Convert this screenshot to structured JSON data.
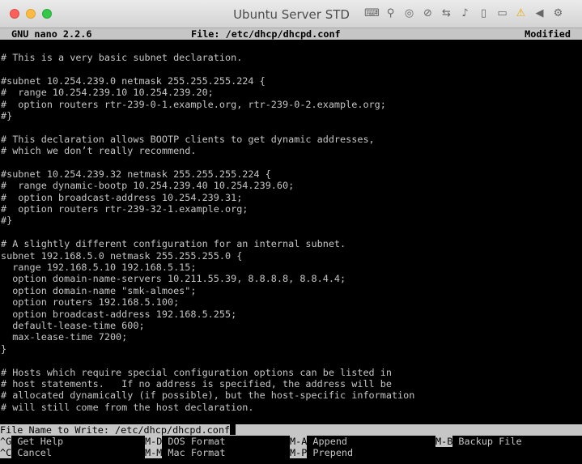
{
  "window": {
    "title": "Ubuntu Server STD",
    "toolbar_icons": [
      "keyboard-icon",
      "usb-icon",
      "disc-icon",
      "cd-blocked-icon",
      "network-icon",
      "audio-icon",
      "removable-drive-icon",
      "shared-folder-icon",
      "warning-icon",
      "back-arrow-icon",
      "settings-gear-icon"
    ]
  },
  "nano": {
    "version": "GNU nano 2.2.6",
    "file": "File: /etc/dhcp/dhcpd.conf",
    "status": "Modified"
  },
  "buffer": {
    "lines": [
      "# This is a very basic subnet declaration.",
      "",
      "#subnet 10.254.239.0 netmask 255.255.255.224 {",
      "#  range 10.254.239.10 10.254.239.20;",
      "#  option routers rtr-239-0-1.example.org, rtr-239-0-2.example.org;",
      "#}",
      "",
      "# This declaration allows BOOTP clients to get dynamic addresses,",
      "# which we don’t really recommend.",
      "",
      "#subnet 10.254.239.32 netmask 255.255.255.224 {",
      "#  range dynamic-bootp 10.254.239.40 10.254.239.60;",
      "#  option broadcast-address 10.254.239.31;",
      "#  option routers rtr-239-32-1.example.org;",
      "#}",
      "",
      "# A slightly different configuration for an internal subnet.",
      "subnet 192.168.5.0 netmask 255.255.255.0 {",
      "  range 192.168.5.10 192.168.5.15;",
      "  option domain-name-servers 10.211.55.39, 8.8.8.8, 8.8.4.4;",
      "  option domain-name \"smk-almoes\";",
      "  option routers 192.168.5.100;",
      "  option broadcast-address 192.168.5.255;",
      "  default-lease-time 600;",
      "  max-lease-time 7200;",
      "}",
      "",
      "# Hosts which require special configuration options can be listed in",
      "# host statements.   If no address is specified, the address will be",
      "# allocated dynamically (if possible), but the host-specific information",
      "# will still come from the host declaration."
    ]
  },
  "prompt": {
    "label": "File Name to Write: ",
    "value": "/etc/dhcp/dhcpd.conf"
  },
  "shortcuts": [
    {
      "key": "^G",
      "label": "Get Help"
    },
    {
      "key": "M-D",
      "label": "DOS Format"
    },
    {
      "key": "M-A",
      "label": "Append"
    },
    {
      "key": "M-B",
      "label": "Backup File"
    },
    {
      "key": "^C",
      "label": "Cancel"
    },
    {
      "key": "M-M",
      "label": "Mac Format"
    },
    {
      "key": "M-P",
      "label": "Prepend"
    }
  ],
  "colors": {
    "terminal_bg": "#000000",
    "terminal_fg": "#c6c6c6",
    "bar_bg": "#c6c6c6"
  }
}
